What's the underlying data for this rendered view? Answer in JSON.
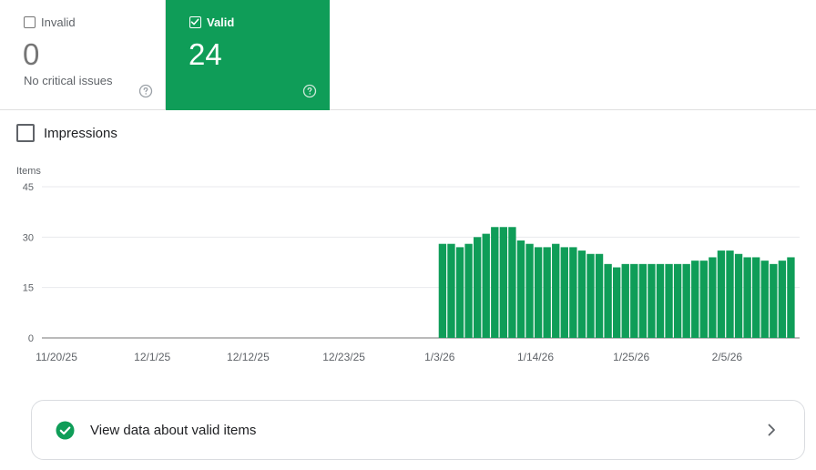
{
  "cards": {
    "invalid": {
      "label": "Invalid",
      "value": "0",
      "sub": "No critical issues",
      "checked": false
    },
    "valid": {
      "label": "Valid",
      "value": "24",
      "checked": true
    }
  },
  "impressions": {
    "label": "Impressions",
    "checked": false
  },
  "footer": {
    "label": "View data about valid items"
  },
  "colors": {
    "valid_green": "#0f9d58",
    "bar_green": "#0f9d58",
    "text_dark": "#202124",
    "text_gray": "#5f6368"
  },
  "icons": {
    "help": "help-circle-icon",
    "check": "check-circle-icon",
    "chevron": "chevron-right-icon"
  },
  "chart_data": {
    "type": "bar",
    "ylabel": "Items",
    "ylim": [
      0,
      45
    ],
    "yticks": [
      "0",
      "15",
      "30",
      "45"
    ],
    "x_ticks": [
      "11/20/25",
      "12/1/25",
      "12/12/25",
      "12/23/25",
      "1/3/26",
      "1/14/26",
      "1/25/26",
      "2/5/26"
    ],
    "x_range": [
      "2025-11-20",
      "2026-02-15"
    ],
    "grid": true,
    "series": [
      {
        "dates": [
          "2026-01-05",
          "2026-01-06",
          "2026-01-07",
          "2026-01-08",
          "2026-01-09",
          "2026-01-10",
          "2026-01-11",
          "2026-01-12",
          "2026-01-13",
          "2026-01-14",
          "2026-01-15",
          "2026-01-16",
          "2026-01-17",
          "2026-01-18",
          "2026-01-19",
          "2026-01-20",
          "2026-01-21",
          "2026-01-22",
          "2026-01-23",
          "2026-01-24",
          "2026-01-25",
          "2026-01-26",
          "2026-01-27",
          "2026-01-28",
          "2026-01-29",
          "2026-01-30",
          "2026-01-31",
          "2026-02-01",
          "2026-02-02",
          "2026-02-03",
          "2026-02-04",
          "2026-02-05",
          "2026-02-06",
          "2026-02-07",
          "2026-02-08",
          "2026-02-09",
          "2026-02-10",
          "2026-02-11",
          "2026-02-12",
          "2026-02-13",
          "2026-02-14"
        ],
        "values": [
          28,
          28,
          27,
          28,
          30,
          31,
          33,
          33,
          33,
          29,
          28,
          27,
          27,
          28,
          27,
          27,
          26,
          25,
          25,
          22,
          21,
          22,
          22,
          22,
          22,
          22,
          22,
          22,
          22,
          23,
          23,
          24,
          26,
          26,
          25,
          24,
          24,
          23,
          22,
          23,
          24
        ]
      }
    ]
  }
}
